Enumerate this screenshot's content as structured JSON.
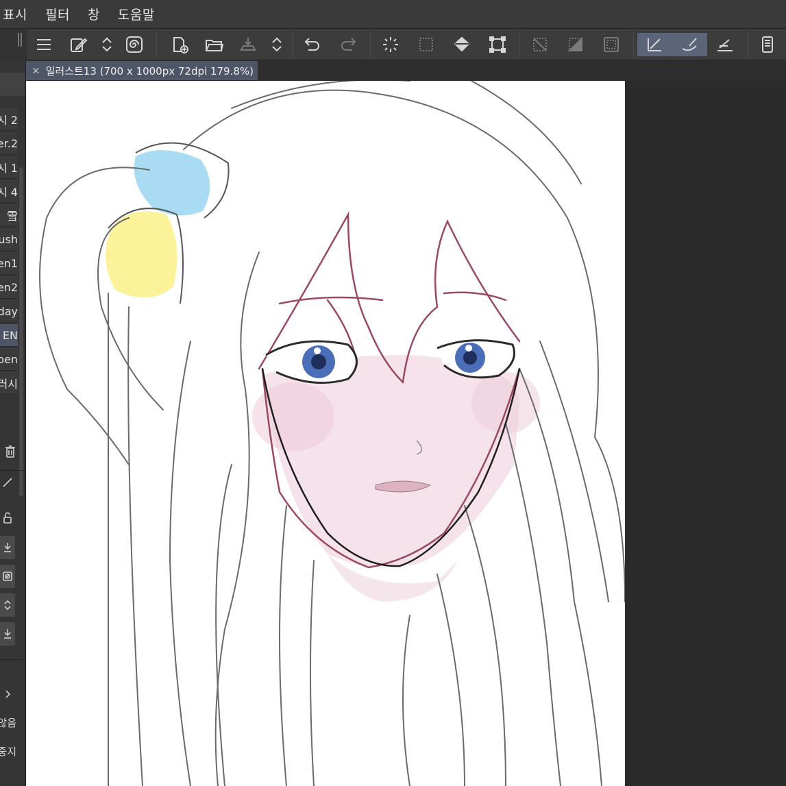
{
  "menu": {
    "items": [
      "표시",
      "필터",
      "창",
      "도움말"
    ]
  },
  "toolbar": {
    "icons": [
      "menu-icon",
      "edit-file-icon",
      "expand-icon",
      "spiral-icon",
      "new-file-icon",
      "open-folder-icon",
      "save-icon",
      "expand-icon",
      "undo-icon",
      "redo-icon",
      "loading-icon",
      "select-icon",
      "fill-icon",
      "transform-icon",
      "clear-selection-icon",
      "invert-icon",
      "border-icon",
      "pen-icon",
      "brush-icon",
      "ruler-pen-icon",
      "device-icon"
    ]
  },
  "document": {
    "tab_label": "일러스트13 (700 x 1000px 72dpi 179.8%)",
    "close_glyph": "×"
  },
  "left_panel": {
    "brushes": [
      "시 2",
      "er.2",
      "시 1",
      "시 4",
      "雪",
      "ush",
      "en1",
      "en2",
      "day",
      "EN",
      "pen",
      "러시"
    ],
    "selected_index": 9,
    "bottom_labels": {
      "none": "않음",
      "stop": "중지"
    }
  },
  "colors": {
    "accent": "#5b6478",
    "hair_clip_blue": "#a9dcf2",
    "hair_clip_yellow": "#fbf29a",
    "eye_blue": "#4a6fb8",
    "hair_line_maroon": "#9a4a5e",
    "skin_blush": "#f3dde6"
  }
}
